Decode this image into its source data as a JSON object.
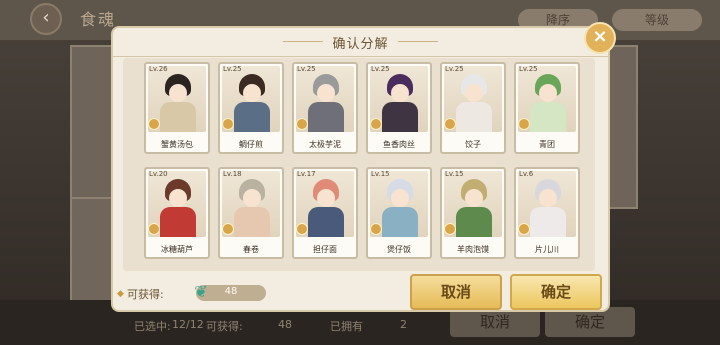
{
  "background": {
    "title": "食魂",
    "sort_label": "降序",
    "level_label": "等级",
    "bottom": {
      "selected_label": "已选中:",
      "selected_value": "12/12",
      "obtain_label": "可获得:",
      "obtain_value": "48",
      "owned_label": "已拥有",
      "owned_value": "2",
      "cancel_label": "取消",
      "confirm_label": "确定"
    }
  },
  "dialog": {
    "title": "确认分解",
    "close_icon": "close-icon",
    "obtain_label": "可获得:",
    "obtain_icon": "feather-icon",
    "obtain_value": "48",
    "cancel_label": "取消",
    "confirm_label": "确定"
  },
  "cards": [
    {
      "level": "Lv.26",
      "name": "蟹黄汤包",
      "hair": "#2b2420",
      "body": "#d9c8a8"
    },
    {
      "level": "Lv.25",
      "name": "鲷仔煎",
      "hair": "#3b2a22",
      "body": "#5a6e86"
    },
    {
      "level": "Lv.25",
      "name": "太极芋泥",
      "hair": "#9a9a9a",
      "body": "#6f6f7a"
    },
    {
      "level": "Lv.25",
      "name": "鱼香肉丝",
      "hair": "#4a2d5c",
      "body": "#3e3442"
    },
    {
      "level": "Lv.25",
      "name": "饺子",
      "hair": "#e7e7ea",
      "body": "#ede8e2"
    },
    {
      "level": "Lv.25",
      "name": "青团",
      "hair": "#6aa65a",
      "body": "#d4e6c4"
    },
    {
      "level": "Lv.20",
      "name": "冰糖葫芦",
      "hair": "#6b3a2a",
      "body": "#c23a34"
    },
    {
      "level": "Lv.18",
      "name": "春卷",
      "hair": "#b9b2a0",
      "body": "#e6c8b0"
    },
    {
      "level": "Lv.17",
      "name": "担仔面",
      "hair": "#e08a78",
      "body": "#4a5a7a"
    },
    {
      "level": "Lv.15",
      "name": "煲仔饭",
      "hair": "#d6dce6",
      "body": "#8ab0c4"
    },
    {
      "level": "Lv.15",
      "name": "羊肉泡馍",
      "hair": "#c2ae72",
      "body": "#5e8a4e"
    },
    {
      "level": "Lv.6",
      "name": "片儿川",
      "hair": "#d8d8dc",
      "body": "#eeeaea"
    }
  ]
}
